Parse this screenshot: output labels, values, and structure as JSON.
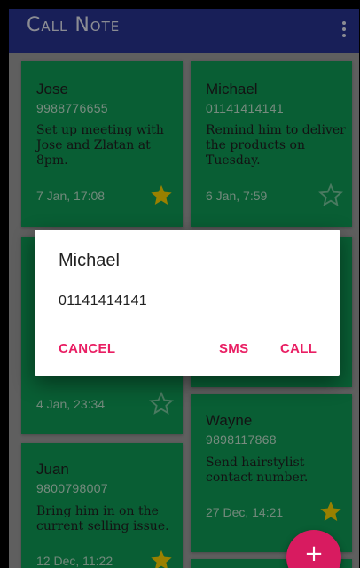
{
  "app": {
    "title": "Call Note",
    "menu_icon": "more-vert-icon",
    "bar_color": "#283593"
  },
  "colors": {
    "note_green": "#0f9d58",
    "star_filled": "#ffd600",
    "accent": "#e91e63",
    "fab": "#d81b60"
  },
  "notes": [
    {
      "name": "Jose",
      "phone": "9988776655",
      "text": "Set up meeting with Jose and Zlatan at 8pm.",
      "date": "7 Jan, 17:08",
      "starred": true
    },
    {
      "name": "Michael",
      "phone": "01141414141",
      "text": "Remind him to deliver the products on Tuesday.",
      "date": "6 Jan, 7:59",
      "starred": false
    },
    {
      "name": "",
      "phone": "",
      "text": "",
      "date": "4 Jan, 23:34",
      "starred": false
    },
    {
      "name": "Wayne",
      "phone": "9898117868",
      "text": "Send hairstylist contact number.",
      "date": "27 Dec, 14:21",
      "starred": true
    },
    {
      "name": "Juan",
      "phone": "9800798007",
      "text": "Bring him in on the current selling issue.",
      "date": "12 Dec, 11:22",
      "starred": true
    }
  ],
  "dialog": {
    "title": "Michael",
    "phone": "01141414141",
    "cancel_label": "CANCEL",
    "sms_label": "SMS",
    "call_label": "CALL"
  },
  "fab": {
    "icon": "add-icon",
    "label": "+"
  }
}
